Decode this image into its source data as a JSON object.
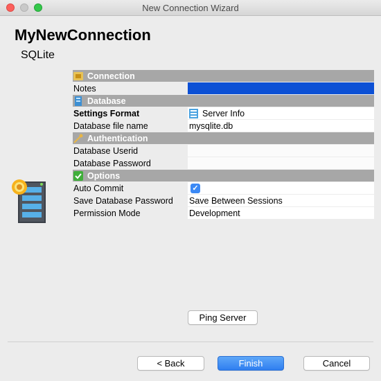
{
  "window": {
    "title": "New Connection Wizard"
  },
  "header": {
    "connection_name": "MyNewConnection",
    "driver": "SQLite"
  },
  "sections": {
    "connection": {
      "label": "Connection",
      "icon": "connection-icon",
      "notes_label": "Notes",
      "notes_value": ""
    },
    "database": {
      "label": "Database",
      "icon": "database-icon",
      "settings_format_label": "Settings Format",
      "settings_format_value": "Server Info",
      "file_name_label": "Database file name",
      "file_name_value": "mysqlite.db"
    },
    "authentication": {
      "label": "Authentication",
      "icon": "key-icon",
      "userid_label": "Database Userid",
      "userid_value": "",
      "password_label": "Database Password",
      "password_value": ""
    },
    "options": {
      "label": "Options",
      "icon": "checkmark-icon",
      "auto_commit_label": "Auto Commit",
      "auto_commit_checked": true,
      "save_password_label": "Save Database Password",
      "save_password_value": "Save Between Sessions",
      "permission_label": "Permission Mode",
      "permission_value": "Development"
    }
  },
  "buttons": {
    "ping": "Ping Server",
    "back": "< Back",
    "finish": "Finish",
    "cancel": "Cancel"
  },
  "colors": {
    "section_header": "#a7a7a7",
    "selection": "#0c50d5",
    "accent": "#3b89f5"
  }
}
